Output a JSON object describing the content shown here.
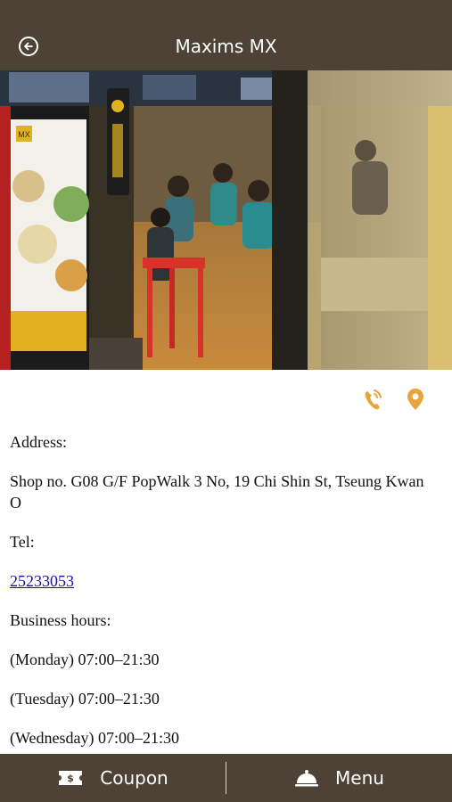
{
  "header": {
    "title": "Maxims MX",
    "back_icon": "back-arrow-circle-icon"
  },
  "photo": {
    "alt": "Restaurant storefront photo",
    "poster_logo": "MX"
  },
  "actions": {
    "call_icon": "phone-call-icon",
    "location_icon": "map-pin-icon",
    "accent_color": "#e8a33a"
  },
  "info": {
    "address_label": "Address:",
    "address_value": "Shop no. G08 G/F PopWalk 3 No, 19 Chi Shin St, Tseung Kwan O",
    "tel_label": "Tel:",
    "tel_value": "25233053",
    "hours_label": "Business hours:",
    "hours": [
      "(Monday) 07:00–21:30",
      "(Tuesday) 07:00–21:30",
      "(Wednesday) 07:00–21:30"
    ]
  },
  "bottom_bar": {
    "coupon_label": "Coupon",
    "coupon_icon": "ticket-icon",
    "menu_label": "Menu",
    "menu_icon": "cloche-icon",
    "bar_color": "#4e4236"
  }
}
